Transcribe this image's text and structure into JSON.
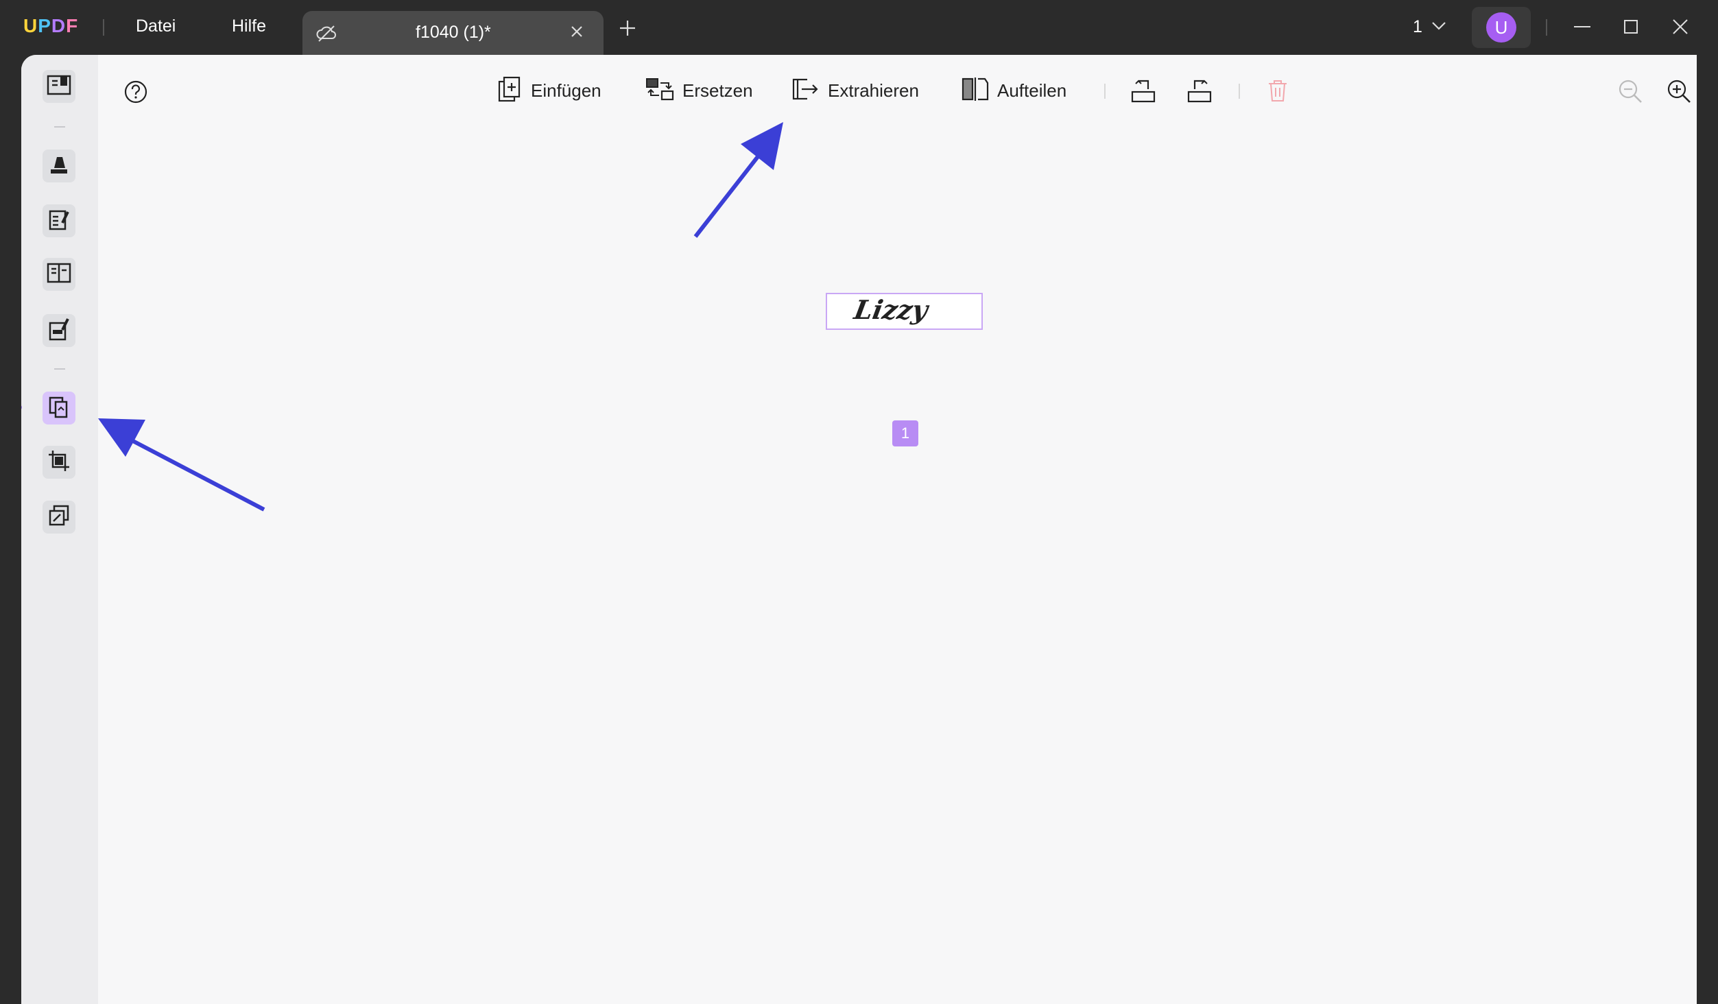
{
  "app": {
    "logo_letters": [
      "U",
      "P",
      "D",
      "F"
    ],
    "logo_colors": [
      "#ffd43b",
      "#4fc3f7",
      "#b57cff",
      "#ff7eb3"
    ]
  },
  "menu": {
    "file": "Datei",
    "help": "Hilfe"
  },
  "tab": {
    "title": "f1040 (1)*"
  },
  "page_selector": {
    "value": "1"
  },
  "user": {
    "initial": "U",
    "avatar_color": "#a65ef2"
  },
  "toolbar": {
    "insert": "Einfügen",
    "replace": "Ersetzen",
    "extract": "Extrahieren",
    "split": "Aufteilen"
  },
  "page": {
    "signature_text": "Lizzy",
    "page_number": "1"
  },
  "colors": {
    "accent": "#a65ef2",
    "arrow": "#3b3fd6",
    "delete_disabled": "#f2a7ad"
  }
}
